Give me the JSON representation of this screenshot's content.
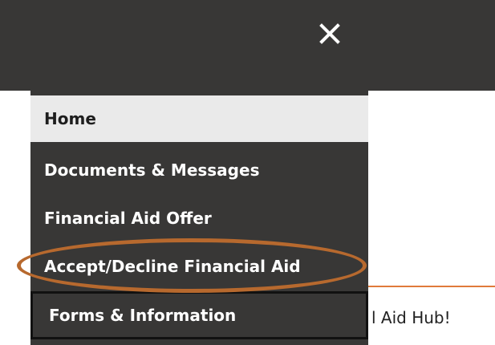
{
  "header": {
    "close_icon": "close-icon"
  },
  "menu": {
    "items": [
      {
        "label": "Home",
        "state": "active"
      },
      {
        "label": "Documents & Messages"
      },
      {
        "label": "Financial Aid Offer"
      },
      {
        "label": "Accept/Decline Financial Aid",
        "state": "circled"
      },
      {
        "label": "Forms & Information",
        "state": "outlined"
      }
    ]
  },
  "background_page": {
    "partial_text": "l Aid Hub!"
  },
  "colors": {
    "header_bg": "#383736",
    "menu_bg": "#383736",
    "active_item_bg": "#eaeaea",
    "circle_annotation": "#b7692e",
    "accent_rule": "#e07a3a"
  }
}
